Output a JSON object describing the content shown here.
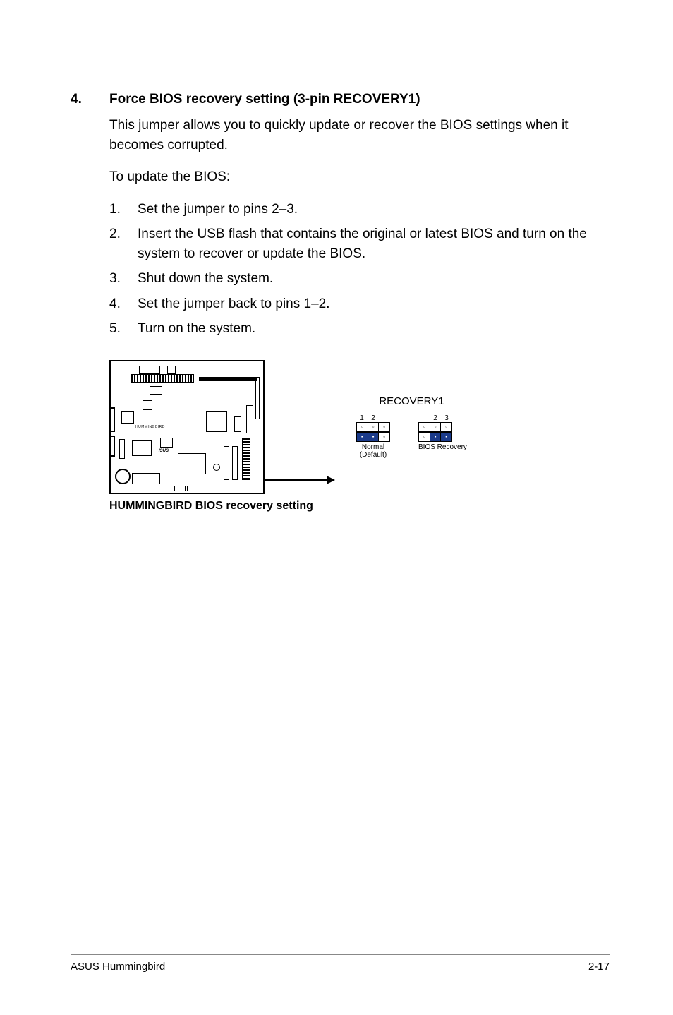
{
  "section_number": "4.",
  "section_title": "Force BIOS recovery setting (3-pin RECOVERY1)",
  "intro": "This jumper allows you to quickly update or recover the BIOS settings when it becomes corrupted.",
  "sub_intro": "To update the BIOS:",
  "steps": [
    {
      "num": "1.",
      "text": "Set the jumper to pins 2–3."
    },
    {
      "num": "2.",
      "text": "Insert the USB flash that contains the original or latest BIOS and turn on the system to recover or update the BIOS."
    },
    {
      "num": "3.",
      "text": "Shut down the system."
    },
    {
      "num": "4.",
      "text": "Set the jumper back to pins 1–2."
    },
    {
      "num": "5.",
      "text": "Turn on the system."
    }
  ],
  "figure": {
    "board_label": "HUMMINGBIRD",
    "recovery_title": "RECOVERY1",
    "jumper_normal": {
      "pin_left_num": "1",
      "pin_mid_num": "2",
      "label_line1": "Normal",
      "label_line2": "(Default)"
    },
    "jumper_recov": {
      "pin_mid_num": "2",
      "pin_right_num": "3",
      "label_line1": "BIOS Recovery"
    },
    "caption": "HUMMINGBIRD BIOS recovery setting"
  },
  "footer_left": "ASUS Hummingbird",
  "footer_right": "2-17"
}
